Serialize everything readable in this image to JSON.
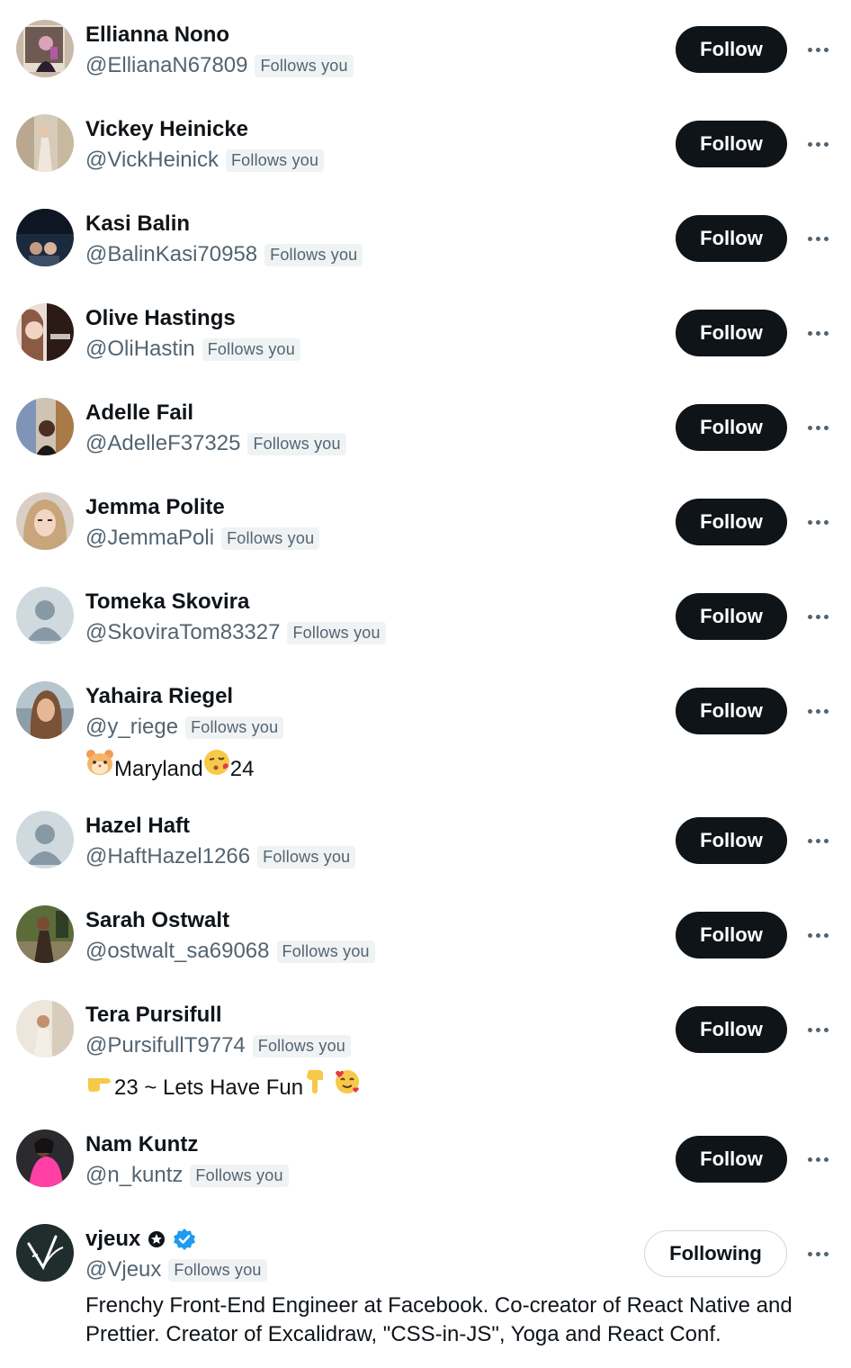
{
  "follow_label": "Follow",
  "following_label": "Following",
  "follows_you_label": "Follows you",
  "users": [
    {
      "name": "Ellianna Nono",
      "handle": "@EllianaN67809",
      "follow": "Follow"
    },
    {
      "name": "Vickey Heinicke",
      "handle": "@VickHeinick",
      "follow": "Follow"
    },
    {
      "name": "Kasi Balin",
      "handle": "@BalinKasi70958",
      "follow": "Follow"
    },
    {
      "name": "Olive Hastings",
      "handle": "@OliHastin",
      "follow": "Follow"
    },
    {
      "name": "Adelle Fail",
      "handle": "@AdelleF37325",
      "follow": "Follow"
    },
    {
      "name": "Jemma Polite",
      "handle": "@JemmaPoli",
      "follow": "Follow"
    },
    {
      "name": "Tomeka Skovira",
      "handle": "@SkoviraTom83327",
      "follow": "Follow"
    },
    {
      "name": "Yahaira Riegel",
      "handle": "@y_riege",
      "follow": "Follow",
      "bio": "Maryland",
      "bio_suffix": "24"
    },
    {
      "name": "Hazel Haft",
      "handle": "@HaftHazel1266",
      "follow": "Follow"
    },
    {
      "name": "Sarah Ostwalt",
      "handle": "@ostwalt_sa69068",
      "follow": "Follow"
    },
    {
      "name": "Tera Pursifull",
      "handle": "@PursifullT9774",
      "follow": "Follow",
      "bio": "23 ~ Lets Have Fun"
    },
    {
      "name": "Nam Kuntz",
      "handle": "@n_kuntz",
      "follow": "Follow"
    },
    {
      "name": "vjeux",
      "handle": "@Vjeux",
      "follow": "Following",
      "bio": "Frenchy Front-End Engineer at Facebook. Co-creator of React Native and Prettier. Creator of Excalidraw, \"CSS-in-JS\", Yoga and React Conf."
    }
  ],
  "colors": {
    "follow_button_bg": "#0f1419",
    "secondary_text": "#536471",
    "badge_bg": "#eff3f4",
    "verified_blue": "#1d9bf0"
  }
}
